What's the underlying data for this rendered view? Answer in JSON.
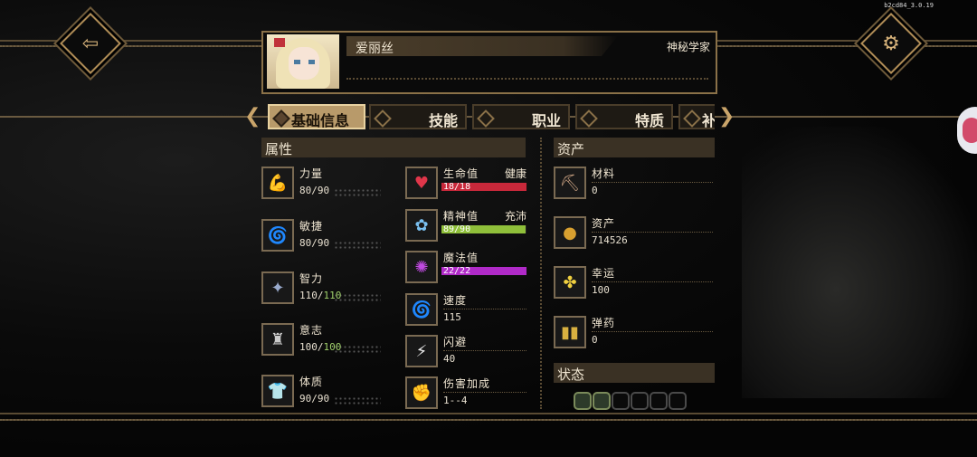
{
  "build": "b2cd84_3.0.19",
  "character": {
    "name": "爱丽丝",
    "role": "神秘学家"
  },
  "tabs": [
    {
      "label": "基础信息",
      "active": true
    },
    {
      "label": "技能",
      "active": false
    },
    {
      "label": "职业",
      "active": false
    },
    {
      "label": "特质",
      "active": false
    },
    {
      "label": "补",
      "active": false
    }
  ],
  "attributes": {
    "title": "属性",
    "items": [
      {
        "label": "力量",
        "value": "80/90",
        "icon": "arm-icon"
      },
      {
        "label": "敏捷",
        "value": "80/90",
        "icon": "wind-icon"
      },
      {
        "label": "智力",
        "value": "110/",
        "value_max": "110",
        "icon": "brain-icon"
      },
      {
        "label": "意志",
        "value": "100/",
        "value_max": "100",
        "icon": "will-icon"
      },
      {
        "label": "体质",
        "value": "90/90",
        "icon": "body-icon"
      }
    ]
  },
  "vitals": {
    "hp": {
      "label": "生命值",
      "status": "健康",
      "value": "18/18",
      "fill": 1.0,
      "color": "#c8283a"
    },
    "sanity": {
      "label": "精神值",
      "status": "充沛",
      "value": "89/90",
      "fill": 0.99,
      "color": "#8fbf3a"
    },
    "mana": {
      "label": "魔法值",
      "value": "22/22",
      "fill": 1.0,
      "color": "#b02ac8"
    },
    "speed": {
      "label": "速度",
      "value": "115"
    },
    "dodge": {
      "label": "闪避",
      "value": "40"
    },
    "damage": {
      "label": "伤害加成",
      "value": "1--4"
    }
  },
  "assets": {
    "title": "资产",
    "items": [
      {
        "label": "材料",
        "value": "0"
      },
      {
        "label": "资产",
        "value": "714526"
      },
      {
        "label": "幸运",
        "value": "100"
      },
      {
        "label": "弹药",
        "value": "0"
      }
    ]
  },
  "status": {
    "title": "状态",
    "slots_filled": 2,
    "slots_total": 6
  }
}
